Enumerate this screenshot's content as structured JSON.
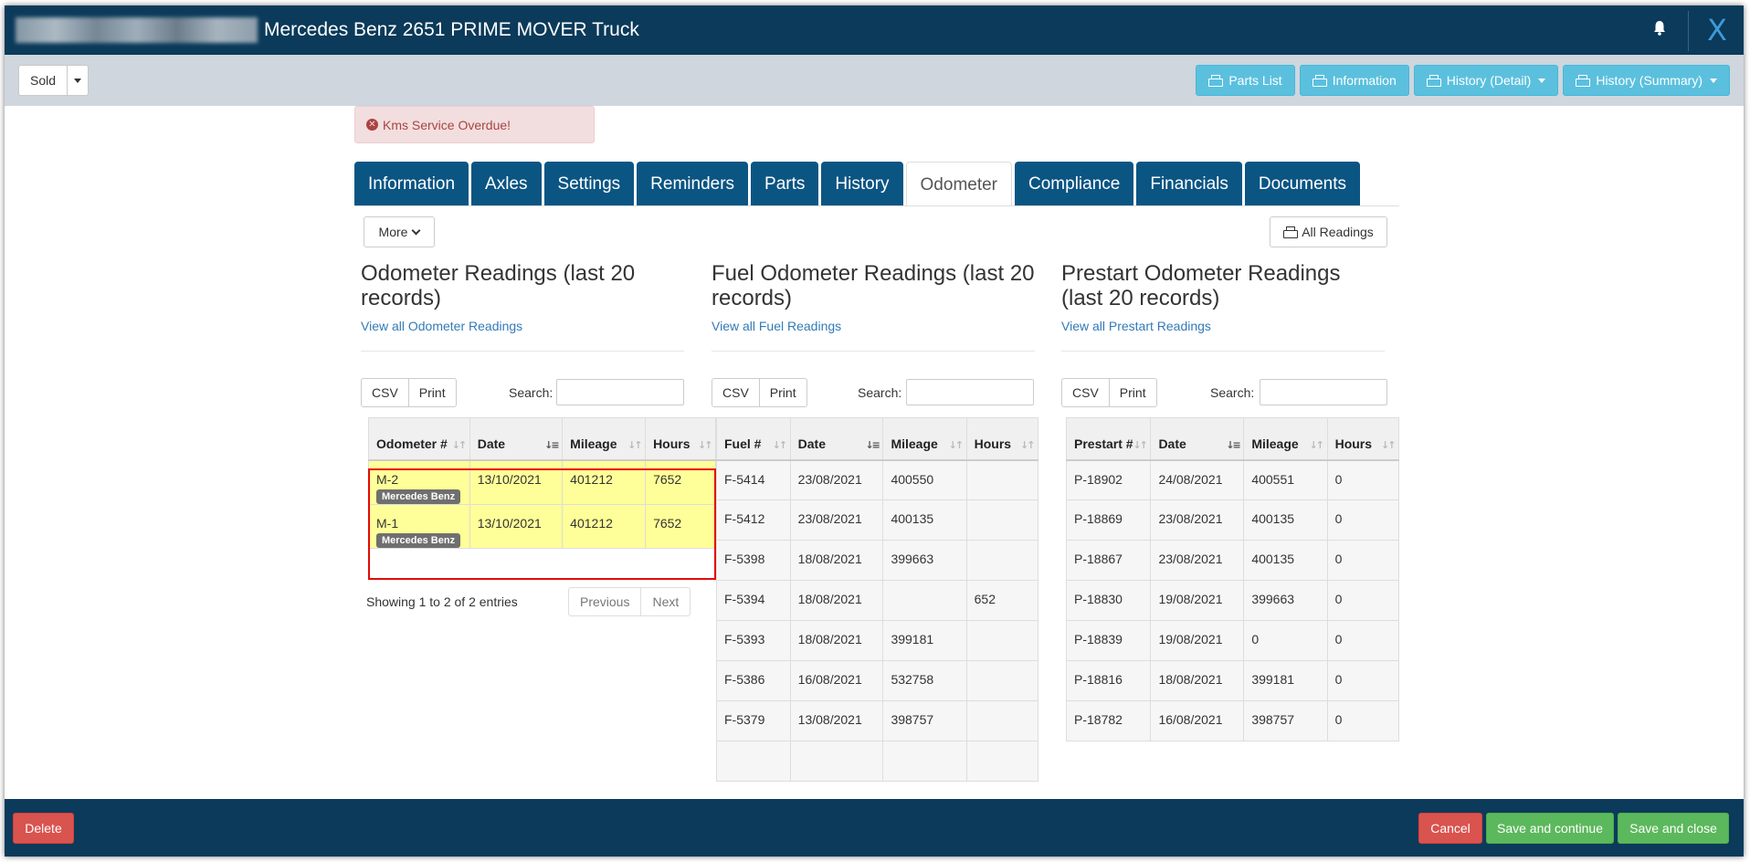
{
  "header": {
    "blurred_id_label": "",
    "title": "Mercedes Benz 2651 PRIME MOVER Truck",
    "close_label": "X"
  },
  "toolbar": {
    "status_value": "Sold",
    "buttons": [
      {
        "label": "Parts List",
        "icon": "printer-icon"
      },
      {
        "label": "Information",
        "icon": "printer-icon"
      },
      {
        "label": "History (Detail)",
        "icon": "printer-icon",
        "dropdown": true
      },
      {
        "label": "History (Summary)",
        "icon": "printer-icon",
        "dropdown": true
      }
    ]
  },
  "alert": {
    "text": "Kms Service Overdue!",
    "icon": "times-circle-icon"
  },
  "tabs": [
    {
      "label": "Information"
    },
    {
      "label": "Axles"
    },
    {
      "label": "Settings"
    },
    {
      "label": "Reminders"
    },
    {
      "label": "Parts"
    },
    {
      "label": "History"
    },
    {
      "label": "Odometer",
      "active": true
    },
    {
      "label": "Compliance"
    },
    {
      "label": "Financials"
    },
    {
      "label": "Documents"
    }
  ],
  "actions": {
    "more_label": "More",
    "all_readings_label": "All Readings"
  },
  "common": {
    "csv_label": "CSV",
    "print_label": "Print",
    "search_label": "Search:",
    "search_value": ""
  },
  "odometer": {
    "heading": "Odometer Readings (last 20 records)",
    "link": "View all Odometer Readings",
    "columns": [
      "Odometer #",
      "Date",
      "Mileage",
      "Hours"
    ],
    "rows": [
      {
        "id": "M-2",
        "badge": "Mercedes Benz",
        "date": "13/10/2021",
        "mileage": "401212",
        "hours": "7652"
      },
      {
        "id": "M-1",
        "badge": "Mercedes Benz",
        "date": "13/10/2021",
        "mileage": "401212",
        "hours": "7652"
      }
    ],
    "showing": "Showing 1 to 2 of 2 entries",
    "previous_label": "Previous",
    "next_label": "Next"
  },
  "fuel": {
    "heading": "Fuel Odometer Readings (last 20 records)",
    "link": "View all Fuel Readings",
    "columns": [
      "Fuel #",
      "Date",
      "Mileage",
      "Hours"
    ],
    "rows": [
      {
        "id": "F-5414",
        "date": "23/08/2021",
        "mileage": "400550",
        "hours": ""
      },
      {
        "id": "F-5412",
        "date": "23/08/2021",
        "mileage": "400135",
        "hours": ""
      },
      {
        "id": "F-5398",
        "date": "18/08/2021",
        "mileage": "399663",
        "hours": ""
      },
      {
        "id": "F-5394",
        "date": "18/08/2021",
        "mileage": "",
        "hours": "652"
      },
      {
        "id": "F-5393",
        "date": "18/08/2021",
        "mileage": "399181",
        "hours": ""
      },
      {
        "id": "F-5386",
        "date": "16/08/2021",
        "mileage": "532758",
        "hours": ""
      },
      {
        "id": "F-5379",
        "date": "13/08/2021",
        "mileage": "398757",
        "hours": ""
      },
      {
        "id": "",
        "date": "",
        "mileage": "",
        "hours": ""
      }
    ]
  },
  "prestart": {
    "heading": "Prestart Odometer Readings (last 20 records)",
    "link": "View all Prestart Readings",
    "columns": [
      "Prestart #",
      "Date",
      "Mileage",
      "Hours"
    ],
    "rows": [
      {
        "id": "P-18902",
        "date": "24/08/2021",
        "mileage": "400551",
        "hours": "0"
      },
      {
        "id": "P-18869",
        "date": "23/08/2021",
        "mileage": "400135",
        "hours": "0"
      },
      {
        "id": "P-18867",
        "date": "23/08/2021",
        "mileage": "400135",
        "hours": "0"
      },
      {
        "id": "P-18830",
        "date": "19/08/2021",
        "mileage": "399663",
        "hours": "0"
      },
      {
        "id": "P-18839",
        "date": "19/08/2021",
        "mileage": "0",
        "hours": "0"
      },
      {
        "id": "P-18816",
        "date": "18/08/2021",
        "mileage": "399181",
        "hours": "0"
      },
      {
        "id": "P-18782",
        "date": "16/08/2021",
        "mileage": "398757",
        "hours": "0"
      }
    ]
  },
  "footer": {
    "delete_label": "Delete",
    "cancel_label": "Cancel",
    "save_continue_label": "Save and continue",
    "save_close_label": "Save and close"
  }
}
